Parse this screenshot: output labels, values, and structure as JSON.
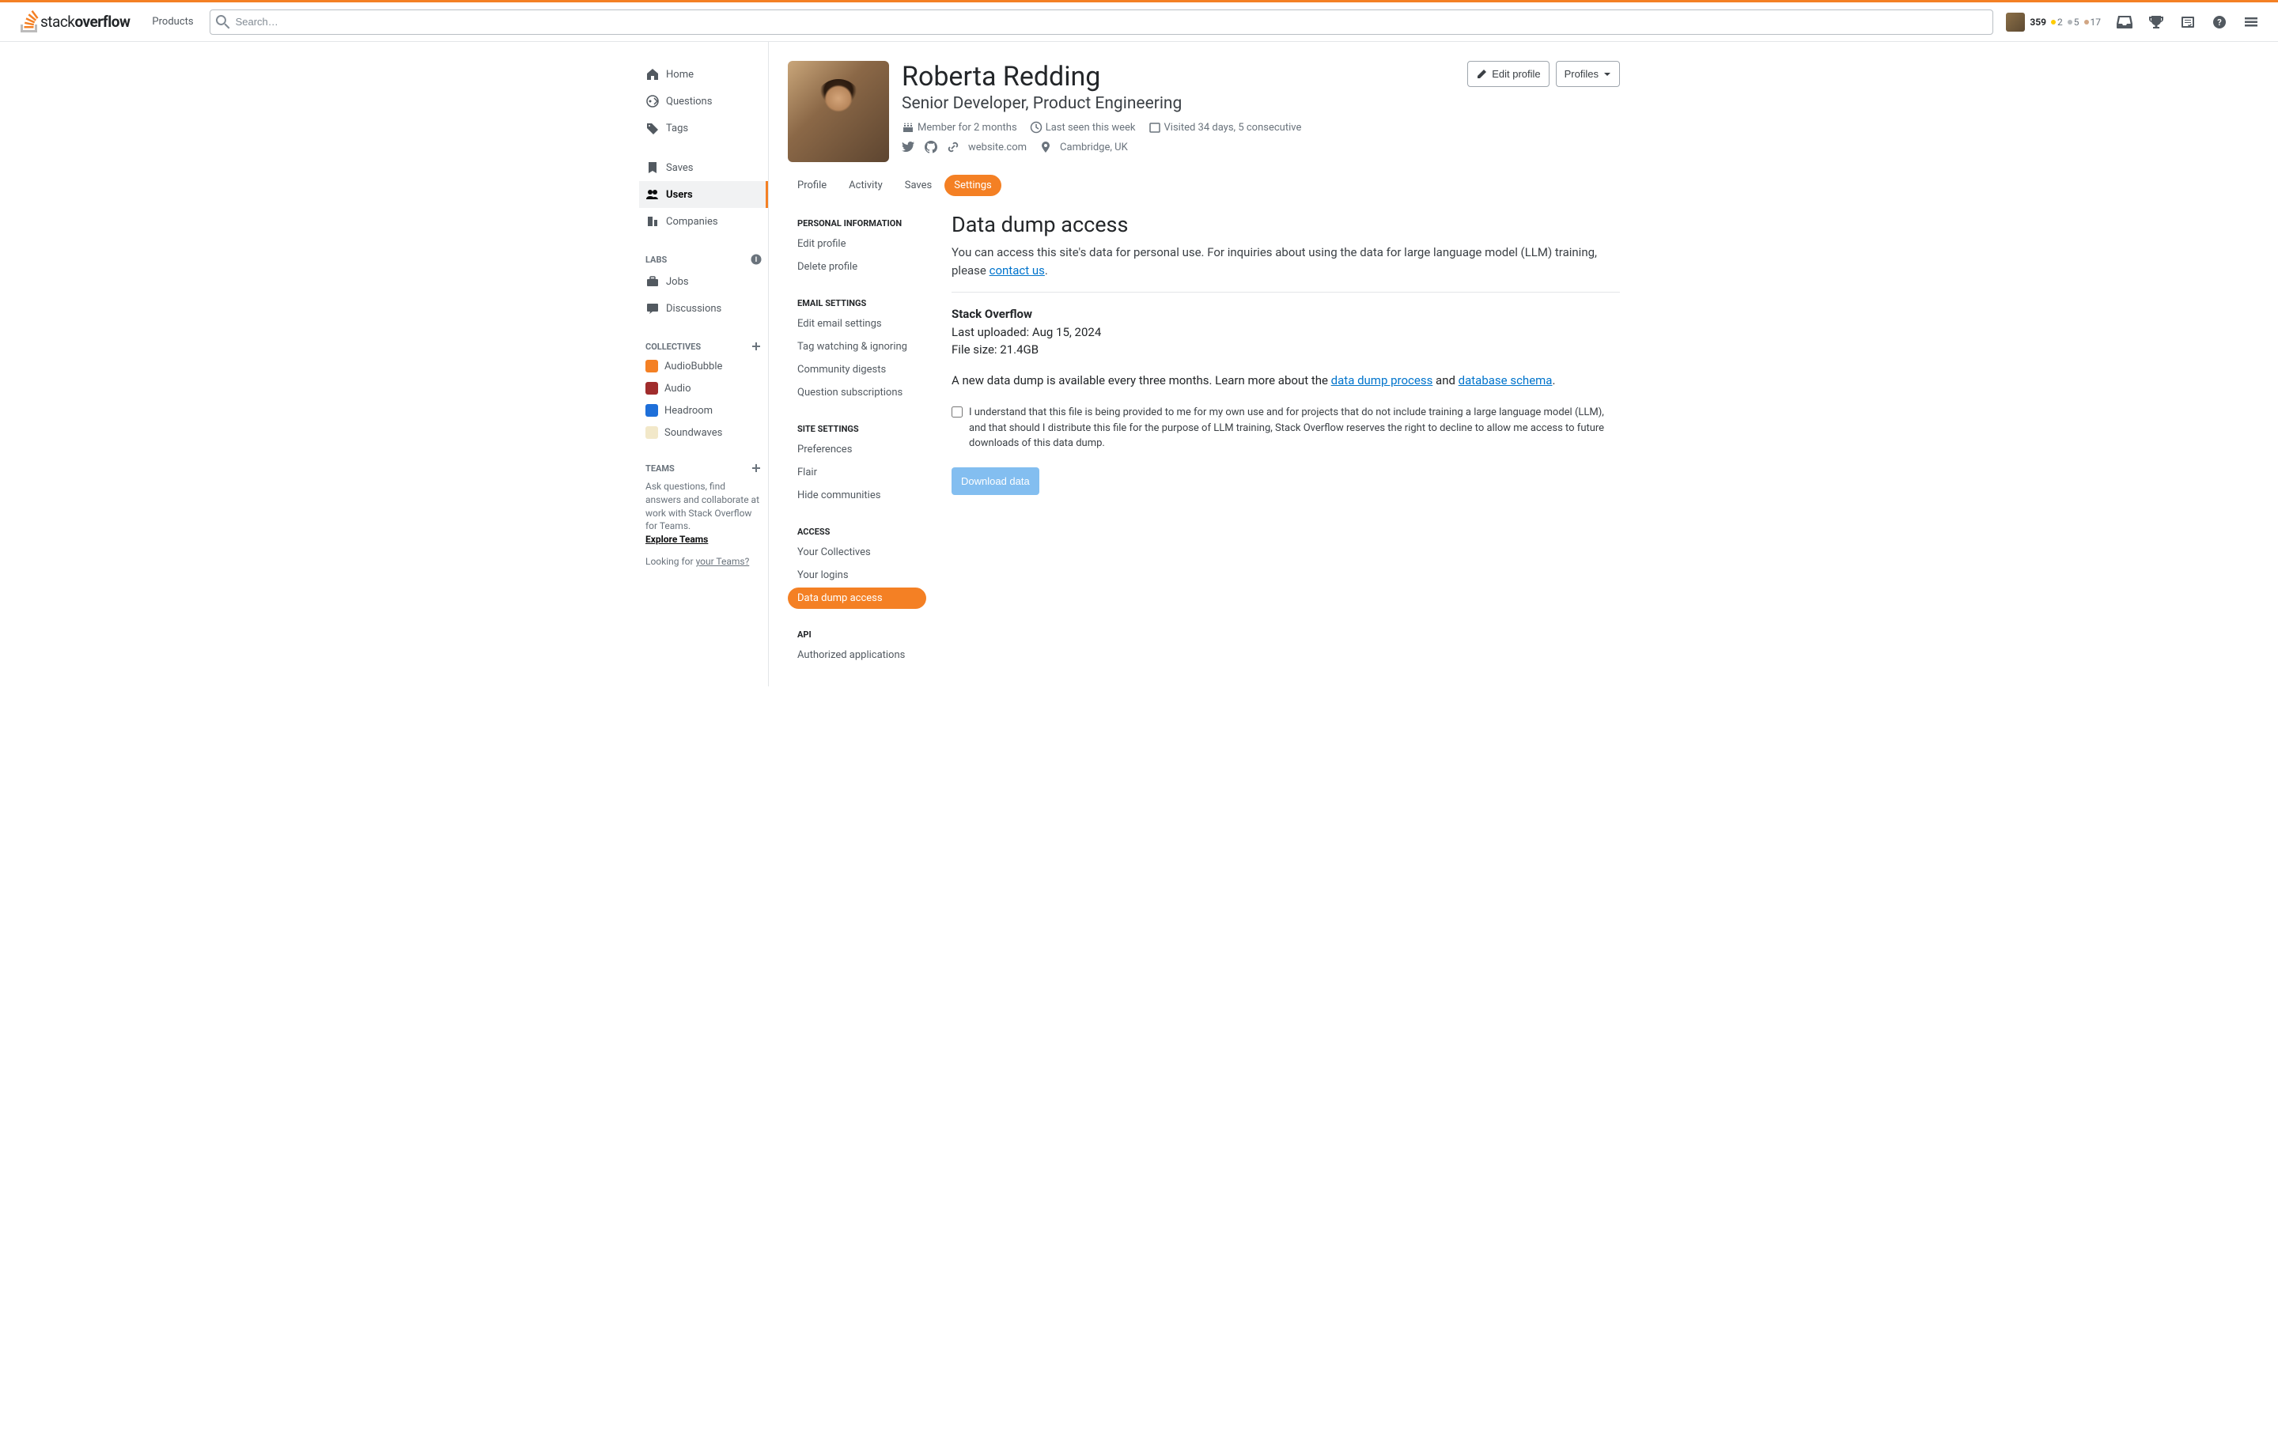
{
  "topbar": {
    "products_label": "Products",
    "search_placeholder": "Search…",
    "reputation": "359",
    "badges": {
      "gold": "2",
      "silver": "5",
      "bronze": "17"
    }
  },
  "left_nav": {
    "home": "Home",
    "questions": "Questions",
    "tags": "Tags",
    "saves": "Saves",
    "users": "Users",
    "companies": "Companies",
    "labs_header": "LABS",
    "jobs": "Jobs",
    "discussions": "Discussions",
    "collectives_header": "COLLECTIVES",
    "collectives": [
      {
        "label": "AudioBubble",
        "color": "#f48024"
      },
      {
        "label": "Audio",
        "color": "#a02c2c"
      },
      {
        "label": "Headroom",
        "color": "#1e6fd9"
      },
      {
        "label": "Soundwaves",
        "color": "#f2e8c9"
      }
    ],
    "teams_header": "TEAMS",
    "teams_text": "Ask questions, find answers and collaborate at work with Stack Overflow for Teams.",
    "teams_link": "Explore Teams",
    "looking_text": "Looking for ",
    "looking_link": "your Teams?"
  },
  "profile": {
    "name": "Roberta Redding",
    "title": "Senior Developer, Product Engineering",
    "member_for": "Member for 2 months",
    "last_seen": "Last seen this week",
    "visited": "Visited 34 days, 5 consecutive",
    "website": "website.com",
    "location": "Cambridge, UK",
    "edit_button": "Edit profile",
    "profiles_button": "Profiles"
  },
  "content_tabs": [
    "Profile",
    "Activity",
    "Saves",
    "Settings"
  ],
  "settings_nav": {
    "personal_header": "PERSONAL INFORMATION",
    "personal": [
      "Edit profile",
      "Delete profile"
    ],
    "email_header": "EMAIL SETTINGS",
    "email": [
      "Edit email settings",
      "Tag watching & ignoring",
      "Community digests",
      "Question subscriptions"
    ],
    "site_header": "SITE SETTINGS",
    "site": [
      "Preferences",
      "Flair",
      "Hide communities"
    ],
    "access_header": "ACCESS",
    "access": [
      "Your Collectives",
      "Your logins",
      "Data dump access"
    ],
    "api_header": "API",
    "api": [
      "Authorized applications"
    ]
  },
  "page": {
    "title": "Data dump access",
    "desc_prefix": "You can access this site's data for personal use. For inquiries about using the data for large language model (LLM) training, please ",
    "desc_link": "contact us",
    "desc_suffix": ".",
    "site_name": "Stack Overflow",
    "last_uploaded_label": "Last uploaded: ",
    "last_uploaded_value": "Aug 15, 2024",
    "file_size_label": "File size: ",
    "file_size_value": "21.4GB",
    "note_prefix": "A new data dump is available every three months. Learn more about the ",
    "note_link1": "data dump process",
    "note_mid": " and ",
    "note_link2": "database schema",
    "note_suffix": ".",
    "consent": "I understand that this file is being provided to me for my own use and for projects that do not include training a large language model (LLM), and that should I distribute this file for the purpose of LLM training, Stack Overflow reserves the right to decline to allow me access to future downloads of this data dump.",
    "download_button": "Download data"
  }
}
